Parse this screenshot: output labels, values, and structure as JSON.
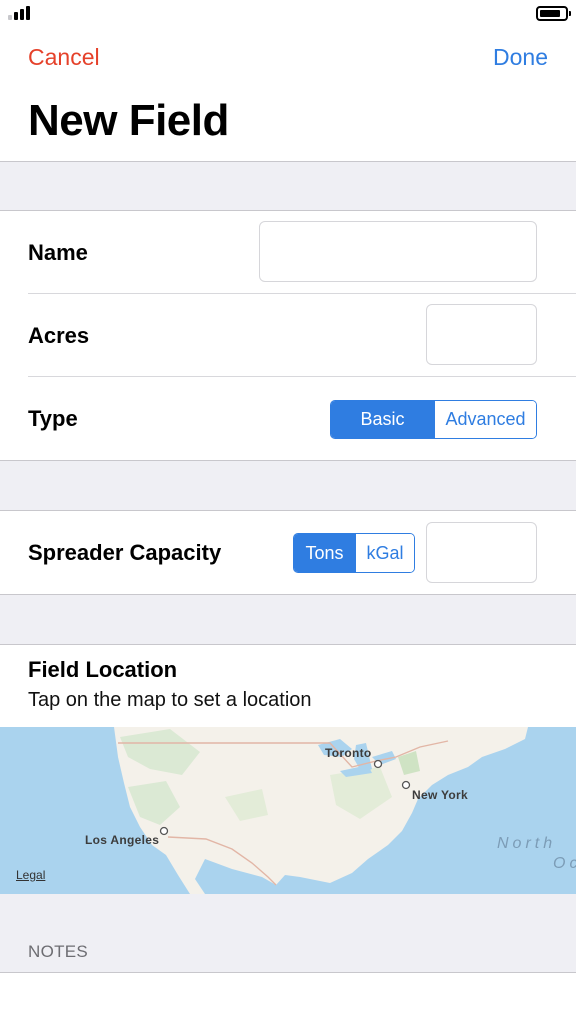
{
  "nav": {
    "cancel_label": "Cancel",
    "done_label": "Done",
    "title": "New Field"
  },
  "form": {
    "name_label": "Name",
    "name_value": "",
    "acres_label": "Acres",
    "acres_value": "",
    "type_label": "Type",
    "type_options": [
      "Basic",
      "Advanced"
    ],
    "type_selected": "Basic",
    "spreader_label": "Spreader Capacity",
    "spreader_units": [
      "Tons",
      "kGal"
    ],
    "spreader_unit_selected": "Tons",
    "spreader_value": ""
  },
  "location": {
    "title": "Field Location",
    "subtitle": "Tap on the map to set a location",
    "map": {
      "cities": [
        "Toronto",
        "New York",
        "Los Angeles"
      ],
      "ocean_label_line1": "North",
      "ocean_label_line2": "Oc",
      "legal_label": "Legal"
    }
  },
  "notes": {
    "header": "NOTES"
  },
  "colors": {
    "accent": "#2f7de1",
    "destructive": "#e5412a",
    "group_background": "#efeff4"
  }
}
